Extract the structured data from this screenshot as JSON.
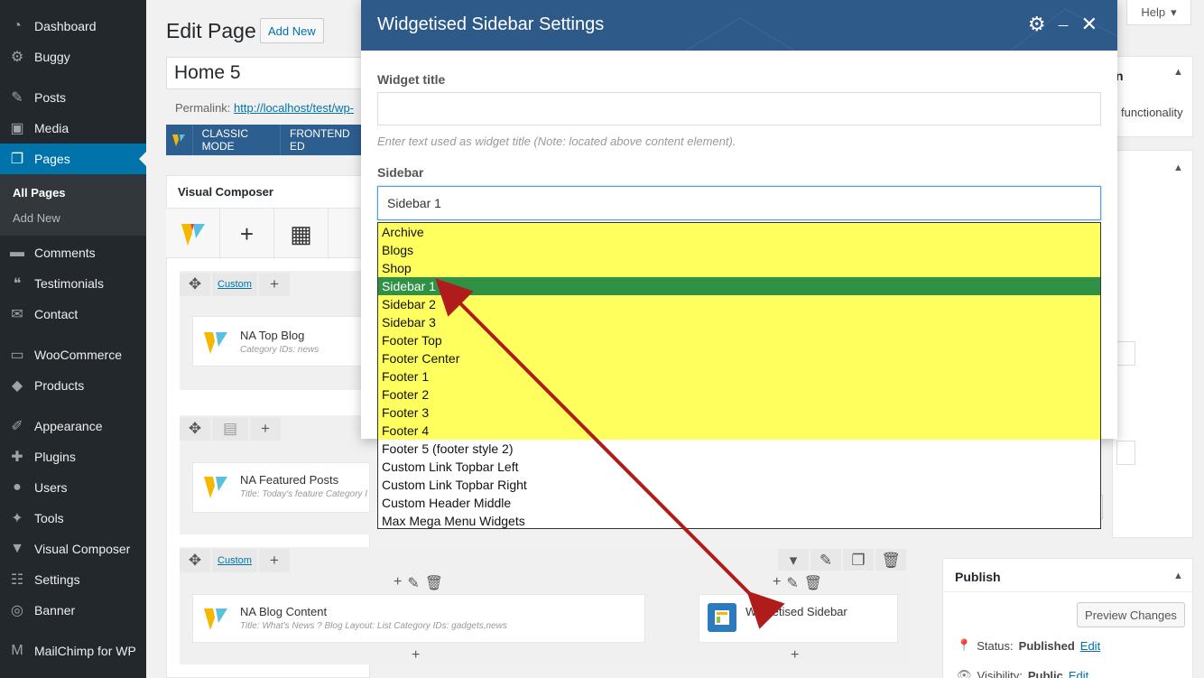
{
  "sidebar": {
    "items": [
      {
        "label": "Dashboard",
        "icon": "dashboard-icon",
        "glyph": "◔"
      },
      {
        "label": "Buggy",
        "icon": "gear-icon",
        "glyph": "⚙"
      },
      {
        "label": "Posts",
        "icon": "pin-icon",
        "glyph": "✎"
      },
      {
        "label": "Media",
        "icon": "media-icon",
        "glyph": "▣"
      },
      {
        "label": "Pages",
        "icon": "pages-icon",
        "glyph": "❐"
      },
      {
        "label": "Comments",
        "icon": "comment-icon",
        "glyph": "▬"
      },
      {
        "label": "Testimonials",
        "icon": "quote-icon",
        "glyph": "❝"
      },
      {
        "label": "Contact",
        "icon": "mail-icon",
        "glyph": "✉"
      },
      {
        "label": "WooCommerce",
        "icon": "woo-icon",
        "glyph": "▭"
      },
      {
        "label": "Products",
        "icon": "products-icon",
        "glyph": "◆"
      },
      {
        "label": "Appearance",
        "icon": "brush-icon",
        "glyph": "✐"
      },
      {
        "label": "Plugins",
        "icon": "plugin-icon",
        "glyph": "✚"
      },
      {
        "label": "Users",
        "icon": "user-icon",
        "glyph": "●"
      },
      {
        "label": "Tools",
        "icon": "wrench-icon",
        "glyph": "✦"
      },
      {
        "label": "Visual Composer",
        "icon": "vc-icon",
        "glyph": "▼"
      },
      {
        "label": "Settings",
        "icon": "settings-icon",
        "glyph": "☷"
      },
      {
        "label": "Banner",
        "icon": "banner-icon",
        "glyph": "◎"
      },
      {
        "label": "MailChimp for WP",
        "icon": "mailchimp-icon",
        "glyph": "M"
      }
    ],
    "submenu": {
      "all_pages": "All Pages",
      "add_new": "Add New"
    }
  },
  "header": {
    "title": "Edit Page",
    "add_new": "Add New",
    "help": "Help"
  },
  "post": {
    "title": "Home 5",
    "permalink_label": "Permalink:",
    "permalink_url": "http://localhost/test/wp-"
  },
  "vc": {
    "classic_mode": "CLASSIC MODE",
    "frontend_editor": "FRONTEND ED",
    "panel_title": "Visual Composer",
    "custom_label": "Custom",
    "elements": [
      {
        "name": "NA Top Blog",
        "sub": "Category IDs: news"
      },
      {
        "name": "NA Featured Posts",
        "sub": "Title: Today's feature  Category I"
      },
      {
        "name": "NA Blog Content",
        "sub": "Title: What's News ?  Blog Layout: List  Category IDs: gadgets,news"
      },
      {
        "name": "Widgetised Sidebar",
        "sub": ""
      }
    ]
  },
  "right": {
    "functionality": "functionality",
    "publish_title": "Publish",
    "preview_changes": "Preview Changes",
    "status_label": "Status:",
    "status_value": "Published",
    "edit": "Edit",
    "visibility_label": "Visibility:",
    "visibility_value": "Public"
  },
  "modal": {
    "title": "Widgetised Sidebar Settings",
    "widget_title_label": "Widget title",
    "widget_title_value": "",
    "widget_title_hint": "Enter text used as widget title (Note: located above content element).",
    "sidebar_label": "Sidebar",
    "sidebar_selected": "Sidebar 1",
    "options": [
      {
        "label": "Archive",
        "state": "highlight"
      },
      {
        "label": "Blogs",
        "state": "highlight"
      },
      {
        "label": "Shop",
        "state": "highlight"
      },
      {
        "label": "Sidebar 1",
        "state": "selected"
      },
      {
        "label": "Sidebar 2",
        "state": "highlight"
      },
      {
        "label": "Sidebar 3",
        "state": "highlight"
      },
      {
        "label": "Footer Top",
        "state": "highlight"
      },
      {
        "label": "Footer Center",
        "state": "highlight"
      },
      {
        "label": "Footer 1",
        "state": "highlight"
      },
      {
        "label": "Footer 2",
        "state": "highlight"
      },
      {
        "label": "Footer 3",
        "state": "highlight"
      },
      {
        "label": "Footer 4",
        "state": "highlight"
      },
      {
        "label": "Footer 5 (footer style 2)",
        "state": "normal"
      },
      {
        "label": "Custom Link Topbar Left",
        "state": "normal"
      },
      {
        "label": "Custom Link Topbar Right",
        "state": "normal"
      },
      {
        "label": "Custom Header Middle",
        "state": "normal"
      },
      {
        "label": "Max Mega Menu Widgets",
        "state": "normal"
      }
    ]
  },
  "colors": {
    "admin_bg": "#23282d",
    "accent": "#0073aa",
    "modal_header": "#2e5a8a",
    "highlight": "#ffff5e",
    "selected": "#2e9145",
    "arrow": "#b01c1c"
  }
}
